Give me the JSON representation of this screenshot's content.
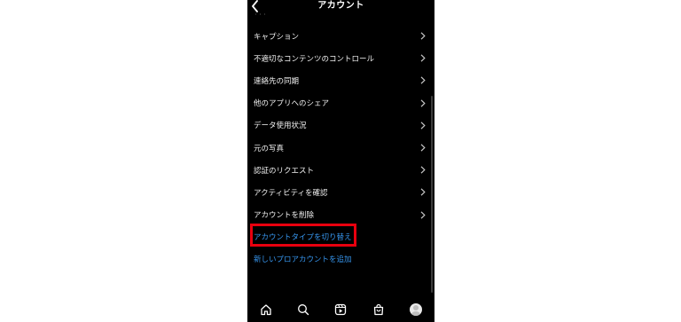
{
  "header": {
    "title": "アカウント",
    "faded_label": "・・・"
  },
  "menu": [
    {
      "label": "キャプション",
      "type": "nav"
    },
    {
      "label": "不適切なコンテンツのコントロール",
      "type": "nav"
    },
    {
      "label": "連絡先の同期",
      "type": "nav"
    },
    {
      "label": "他のアプリへのシェア",
      "type": "nav"
    },
    {
      "label": "データ使用状況",
      "type": "nav"
    },
    {
      "label": "元の写真",
      "type": "nav"
    },
    {
      "label": "認証のリクエスト",
      "type": "nav"
    },
    {
      "label": "アクティビティを確認",
      "type": "nav"
    },
    {
      "label": "アカウントを削除",
      "type": "nav"
    },
    {
      "label": "アカウントタイプを切り替え",
      "type": "link",
      "highlighted": true
    },
    {
      "label": "新しいプロアカウントを追加",
      "type": "link"
    }
  ],
  "colors": {
    "background": "#000000",
    "text": "#f2f2f2",
    "link": "#3797f0",
    "highlight_border": "#e8000e"
  },
  "tabbar": {
    "icons": [
      "home-icon",
      "search-icon",
      "reels-icon",
      "shop-icon",
      "profile-avatar"
    ]
  }
}
